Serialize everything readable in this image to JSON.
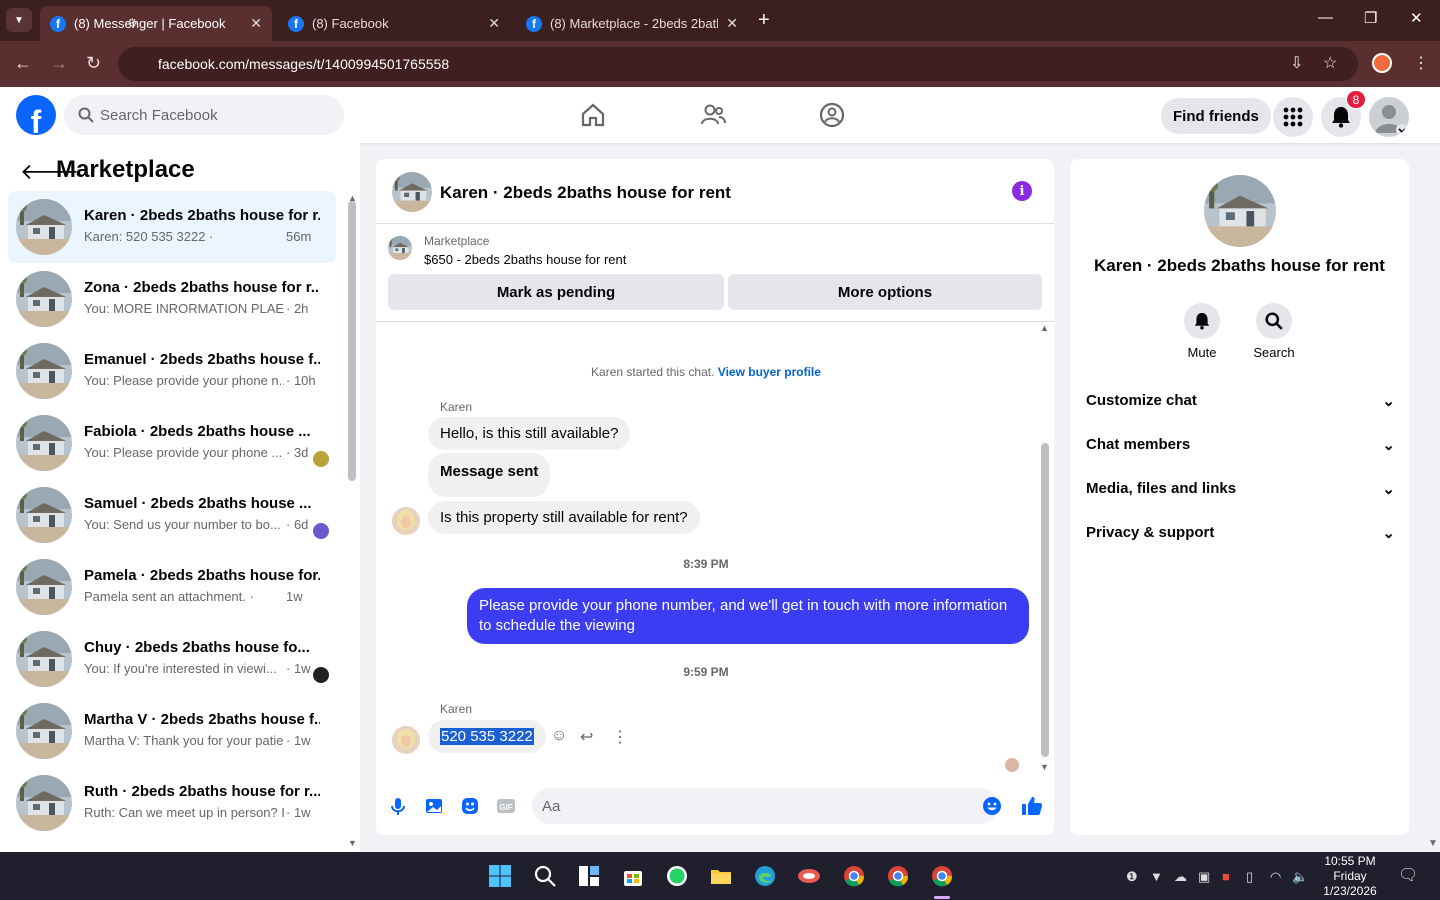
{
  "browser": {
    "tabs": [
      {
        "label": "(8) Messenger | Facebook",
        "active": true
      },
      {
        "label": "(8) Facebook",
        "active": false
      },
      {
        "label": "(8) Marketplace - 2beds 2baths",
        "active": false
      }
    ],
    "url": "facebook.com/messages/t/1400994501765558"
  },
  "header": {
    "search_placeholder": "Search Facebook",
    "find_friends": "Find friends",
    "notification_count": "8"
  },
  "sidebar": {
    "title": "Marketplace",
    "conversations": [
      {
        "name": "Karen · 2beds 2baths house for r...",
        "preview": "Karen: 520 535 3222 · ",
        "time": "56m",
        "active": true
      },
      {
        "name": "Zona · 2beds 2baths house for r...",
        "preview": "You: MORE INRORMATION PLAES ...",
        "time": "· 2h"
      },
      {
        "name": "Emanuel · 2beds 2baths house f...",
        "preview": "You: Please provide your phone n...",
        "time": "· 10h"
      },
      {
        "name": "Fabiola · 2beds 2baths house ...",
        "preview": "You: Please provide your phone ...",
        "time": "· 3d"
      },
      {
        "name": "Samuel · 2beds 2baths house ...",
        "preview": "You: Send us your number to bo...",
        "time": "· 6d"
      },
      {
        "name": "Pamela · 2beds 2baths house for...",
        "preview": "Pamela sent an attachment. · ",
        "time": "1w"
      },
      {
        "name": "Chuy · 2beds 2baths house fo...",
        "preview": "You: If you're interested in viewi...",
        "time": "· 1w"
      },
      {
        "name": "Martha V · 2beds 2baths house f...",
        "preview": "Martha V: Thank you for your patie...",
        "time": "· 1w"
      },
      {
        "name": "Ruth · 2beds 2baths house for r...",
        "preview": "Ruth: Can we meet up in person? I ...",
        "time": "· 1w"
      }
    ]
  },
  "chat": {
    "title": "Karen · 2beds 2baths house for rent",
    "listing_label": "Marketplace",
    "listing_price_title": "$650 - 2beds 2baths house for rent",
    "mark_pending": "Mark as pending",
    "more_options": "More options",
    "started_text": "Karen started this chat. ",
    "view_buyer_profile": "View buyer profile",
    "sender_name": "Karen",
    "messages": {
      "m1": "Hello, is this still available?",
      "m2": "Message sent",
      "m3": "Is this property still available for rent?",
      "time1": "8:39 PM",
      "out1": "Please provide your phone number, and we'll get in touch with more information to schedule the viewing",
      "time2": "9:59 PM",
      "m4": "520 535 3222"
    },
    "composer_placeholder": "Aa"
  },
  "right_panel": {
    "name": "Karen · 2beds 2baths house for rent",
    "mute_label": "Mute",
    "search_label": "Search",
    "sections": [
      "Customize chat",
      "Chat members",
      "Media, files and links",
      "Privacy & support"
    ]
  },
  "taskbar": {
    "time": "10:55 PM",
    "day": "Friday",
    "date": "1/23/2026"
  },
  "colors": {
    "facebook_blue": "#0866ff",
    "outgoing_bubble": "#3c3cf2",
    "browser_frame": "#3c1f1f"
  }
}
